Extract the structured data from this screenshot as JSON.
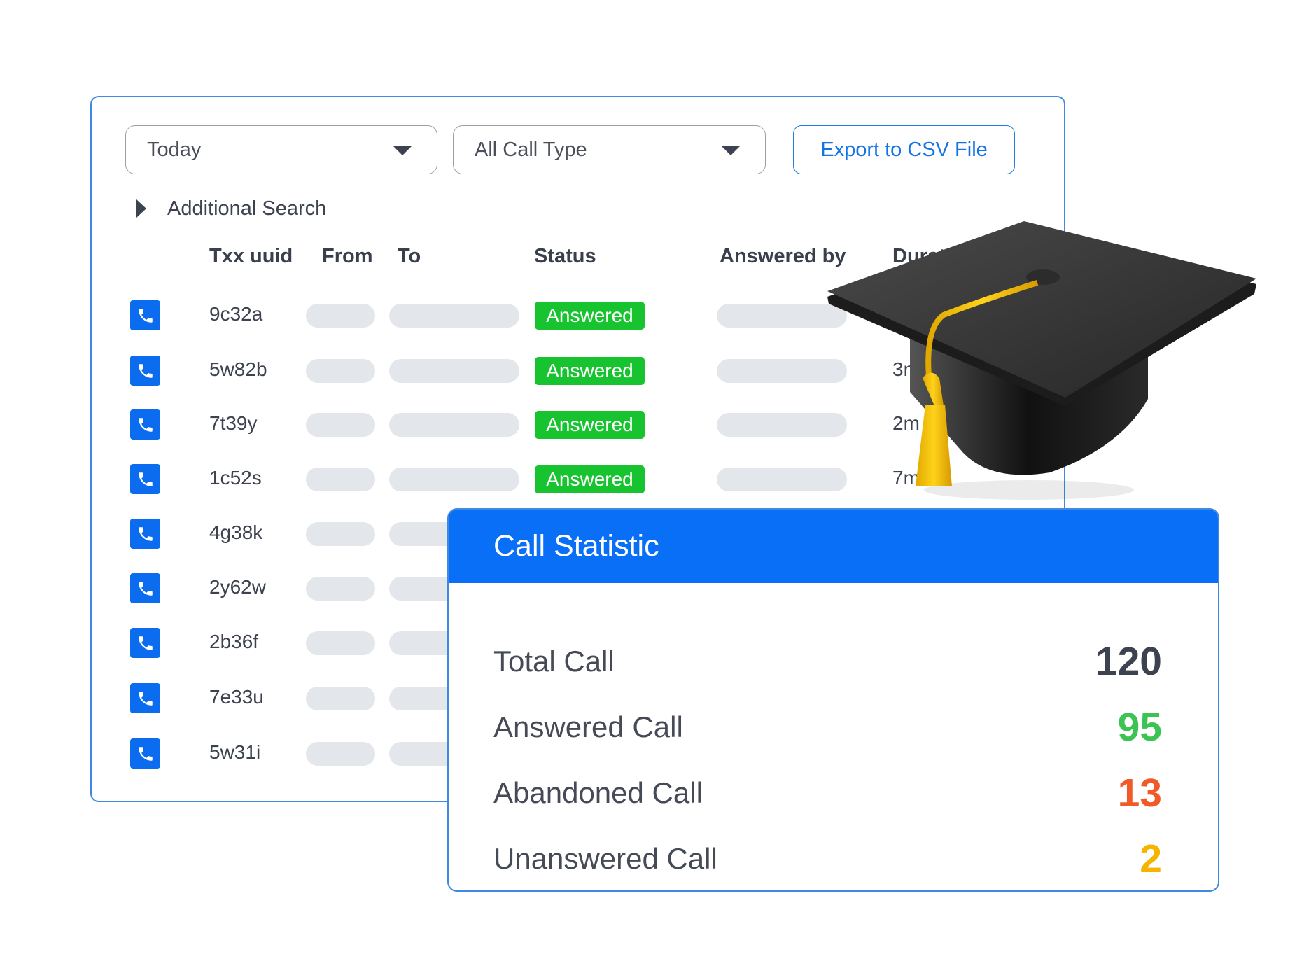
{
  "filters": {
    "date_range": "Today",
    "call_type": "All Call Type",
    "export_label": "Export to CSV File",
    "additional_search": "Additional Search"
  },
  "table": {
    "headers": [
      "Txx uuid",
      "From",
      "To",
      "Status",
      "Answered by",
      "Duration"
    ],
    "rows": [
      {
        "uuid": "9c32a",
        "status": "Answered",
        "duration": ""
      },
      {
        "uuid": "5w82b",
        "status": "Answered",
        "duration": "3m"
      },
      {
        "uuid": "7t39y",
        "status": "Answered",
        "duration": "2m"
      },
      {
        "uuid": "1c52s",
        "status": "Answered",
        "duration": "7m"
      },
      {
        "uuid": "4g38k"
      },
      {
        "uuid": "2y62w"
      },
      {
        "uuid": "2b36f"
      },
      {
        "uuid": "7e33u"
      },
      {
        "uuid": "5w31i"
      }
    ]
  },
  "stats": {
    "title": "Call Statistic",
    "items": [
      {
        "label": "Total Call",
        "value": "120",
        "color": "#3d4250"
      },
      {
        "label": "Answered Call",
        "value": "95",
        "color": "#3cc453"
      },
      {
        "label": "Abandoned Call",
        "value": "13",
        "color": "#f05a28"
      },
      {
        "label": "Unanswered Call",
        "value": "2",
        "color": "#f5b400"
      }
    ]
  },
  "colors": {
    "accent": "#0a6ff7",
    "answered_badge": "#17c42f"
  },
  "icons": {
    "row_icon": "phone-icon",
    "decoration": "graduation-cap-icon"
  }
}
